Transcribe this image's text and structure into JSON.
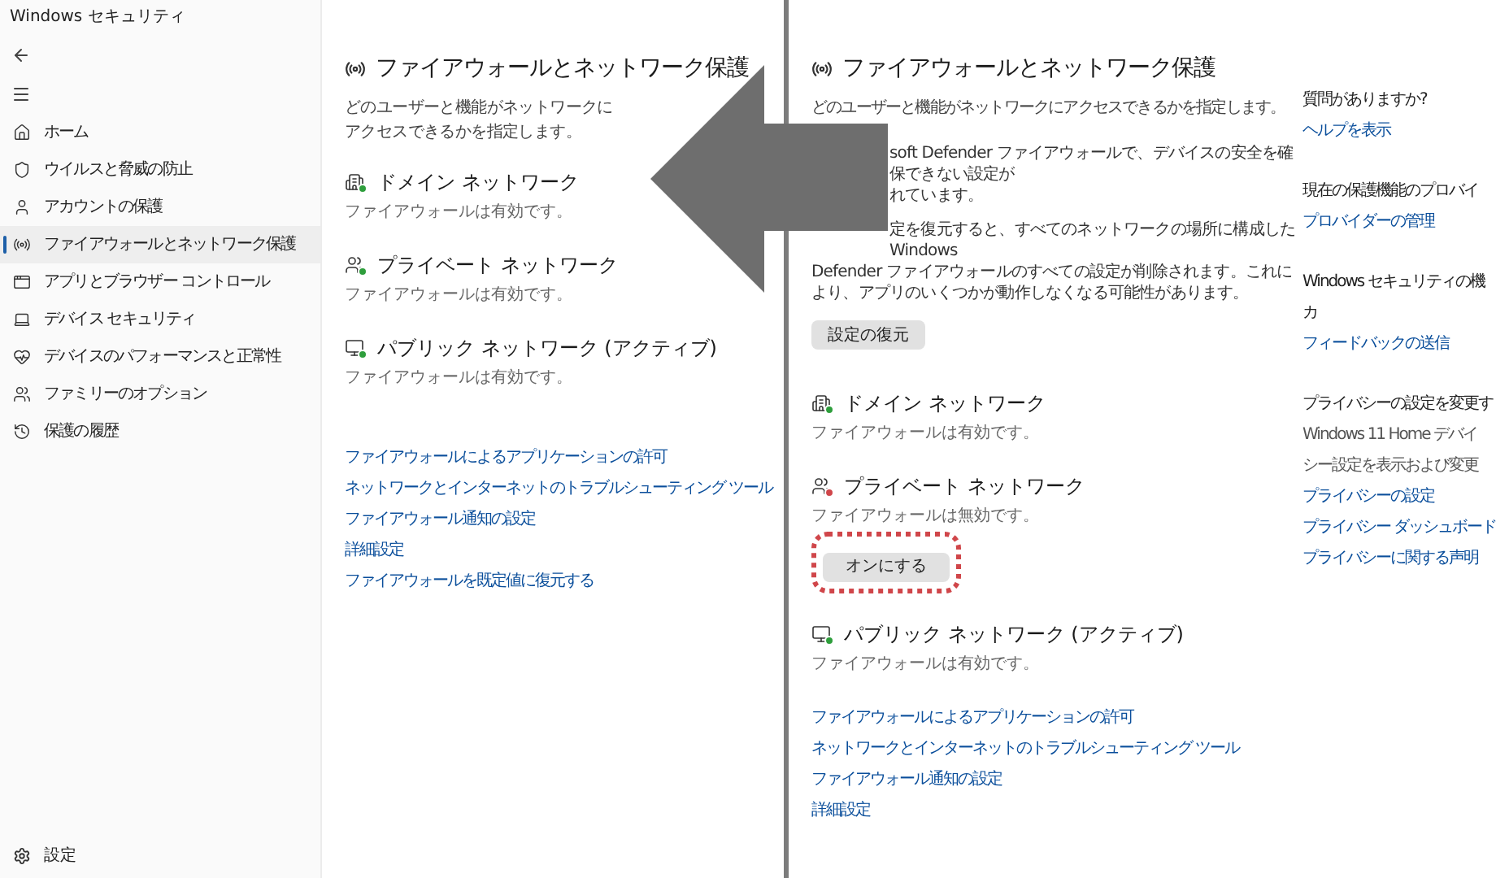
{
  "left_window": {
    "title": "Windows セキュリティ",
    "sidebar": {
      "items": [
        {
          "kind": "home",
          "label": "ホーム",
          "selected": false
        },
        {
          "kind": "shield",
          "label": "ウイルスと脅威の防止",
          "selected": false
        },
        {
          "kind": "account",
          "label": "アカウントの保護",
          "selected": false
        },
        {
          "kind": "firewall",
          "label": "ファイアウォールとネットワーク保護",
          "selected": true
        },
        {
          "kind": "app",
          "label": "アプリとブラウザー コントロール",
          "selected": false
        },
        {
          "kind": "device",
          "label": "デバイス セキュリティ",
          "selected": false
        },
        {
          "kind": "health",
          "label": "デバイスのパフォーマンスと正常性",
          "selected": false
        },
        {
          "kind": "family",
          "label": "ファミリーのオプション",
          "selected": false
        },
        {
          "kind": "history",
          "label": "保護の履歴",
          "selected": false
        }
      ],
      "settings": "設定"
    },
    "page": {
      "heading": "ファイアウォールとネットワーク保護",
      "subtitle": "どのユーザーと機能がネットワークにアクセスできるかを指定します。",
      "networks": [
        {
          "kind": "domain",
          "name": "ドメイン ネットワーク",
          "status": "ファイアウォールは有効です。",
          "enabled": true
        },
        {
          "kind": "private",
          "name": "プライベート ネットワーク",
          "status": "ファイアウォールは有効です。",
          "enabled": true
        },
        {
          "kind": "public",
          "name": "パブリック ネットワーク (アクティブ)",
          "status": "ファイアウォールは有効です。",
          "enabled": true
        }
      ],
      "links": [
        "ファイアウォールによるアプリケーションの許可",
        "ネットワークとインターネットのトラブルシューティング ツール",
        "ファイアウォール通知の設定",
        "詳細設定",
        "ファイアウォールを既定値に復元する"
      ]
    }
  },
  "right_window": {
    "page": {
      "heading": "ファイアウォールとネットワーク保護",
      "subtitle": "どのユーザーと機能がネットワークにアクセスできるかを指定します。",
      "warning": {
        "paragraphs": [
          {
            "lines": [
              {
                "text": "soft Defender ファイアウォールで、デバイスの安全を確保できない設定が",
                "partly_hidden": true
              },
              {
                "text": "れています。",
                "partly_hidden": true
              }
            ]
          },
          {
            "lines": [
              {
                "text": "定を復元すると、すべてのネットワークの場所に構成した Windows",
                "partly_hidden": true
              },
              {
                "text": "Defender ファイアウォールのすべての設定が削除されます。これにより、アプリのいくつかが動作しなくなる可能性があります。",
                "partly_hidden": false
              }
            ]
          }
        ],
        "button": "設定の復元"
      },
      "networks": [
        {
          "kind": "domain",
          "name": "ドメイン ネットワーク",
          "status": "ファイアウォールは有効です。",
          "enabled": true
        },
        {
          "kind": "private",
          "name": "プライベート ネットワーク",
          "status": "ファイアウォールは無効です。",
          "enabled": false,
          "button": "オンにする",
          "highlighted": true
        },
        {
          "kind": "public",
          "name": "パブリック ネットワーク (アクティブ)",
          "status": "ファイアウォールは有効です。",
          "enabled": true
        }
      ],
      "links": [
        "ファイアウォールによるアプリケーションの許可",
        "ネットワークとインターネットのトラブルシューティング ツール",
        "ファイアウォール通知の設定",
        "詳細設定"
      ]
    },
    "side_panel": [
      {
        "heading_lines": [
          "質問がありますか?"
        ],
        "links": [
          "ヘルプを表示"
        ]
      },
      {
        "heading_lines": [
          "現在の保護機能のプロバイ"
        ],
        "links": [
          "プロバイダーの管理"
        ]
      },
      {
        "heading_lines": [
          "Windows セキュリティの機",
          "カ"
        ],
        "links": [
          "フィードバックの送信"
        ]
      },
      {
        "heading_lines": [
          "プライバシーの設定を変更す"
        ],
        "text_lines": [
          "Windows 11 Home デバイ",
          "シー設定を表示および変更"
        ],
        "links": [
          "プライバシーの設定",
          "プライバシー ダッシュボード",
          "プライバシーに関する声明"
        ]
      }
    ]
  }
}
